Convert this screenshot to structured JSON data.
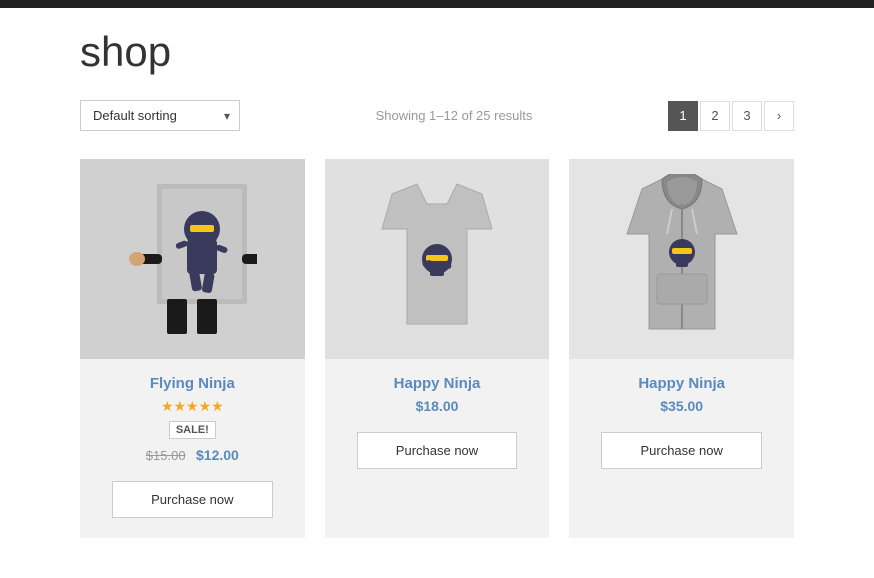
{
  "topbar": {},
  "page": {
    "title": "shop"
  },
  "toolbar": {
    "sort_label": "Default sorting",
    "results_text": "Showing 1–12 of 25 results"
  },
  "pagination": {
    "pages": [
      "1",
      "2",
      "3"
    ],
    "active": "1",
    "next_label": "›"
  },
  "products": [
    {
      "id": 1,
      "name": "Flying Ninja",
      "stars": "★★★★★",
      "has_sale": true,
      "sale_badge": "SALE!",
      "price_old": "$15.00",
      "price_current": "$12.00",
      "btn_label": "Purchase now",
      "image_type": "poster"
    },
    {
      "id": 2,
      "name": "Happy Ninja",
      "stars": "",
      "has_sale": false,
      "sale_badge": "",
      "price_old": "",
      "price_current": "$18.00",
      "btn_label": "Purchase now",
      "image_type": "tshirt"
    },
    {
      "id": 3,
      "name": "Happy Ninja",
      "stars": "",
      "has_sale": false,
      "sale_badge": "",
      "price_old": "",
      "price_current": "$35.00",
      "btn_label": "Purchase now",
      "image_type": "hoodie"
    }
  ]
}
